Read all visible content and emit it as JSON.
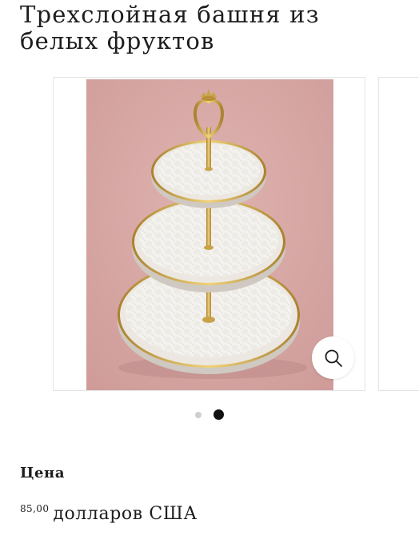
{
  "product": {
    "title": "Трехслойная башня из белых фруктов"
  },
  "gallery": {
    "image_alt": "Three-tier white fruit stand with gold rims and gold center rod on pink background",
    "slide_count": 2,
    "active_slide": 2,
    "zoom_icon": "magnifier-icon"
  },
  "price_block": {
    "label": "Цена",
    "amount": "85,00",
    "currency": "долларов США"
  },
  "colors": {
    "image_background": "#d9a9a6",
    "gold": "#c9a34a",
    "plate": "#f4f2ee",
    "active_dot": "#111111",
    "inactive_dot": "#cfcfcf"
  }
}
